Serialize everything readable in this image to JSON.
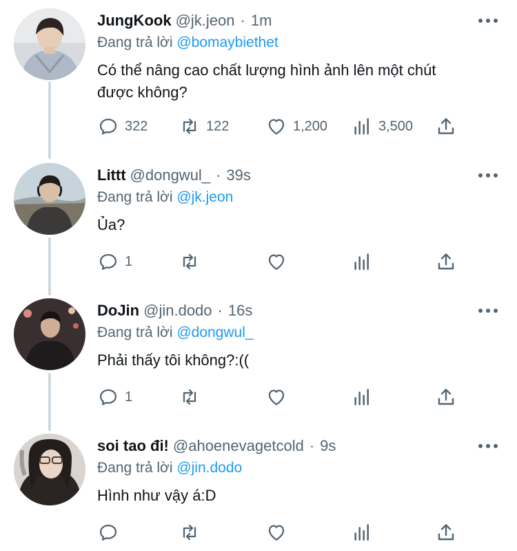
{
  "tweets": [
    {
      "name": "JungKook",
      "handle": "@jk.jeon",
      "time": "1m",
      "reply_prefix": "Đang trả lời",
      "reply_to": "@bomaybiethet",
      "text_lines": [
        "Có thể nâng cao chất lượng hình ảnh lên một chút",
        "được không?"
      ],
      "replies": "322",
      "retweets": "122",
      "likes": "1,200",
      "views": "3,500"
    },
    {
      "name": "Littt",
      "handle": "@dongwul_",
      "time": "39s",
      "reply_prefix": "Đang trả lời",
      "reply_to": "@jk.jeon",
      "text_lines": [
        "Ủa?"
      ],
      "replies": "1",
      "retweets": "",
      "likes": "",
      "views": ""
    },
    {
      "name": "DoJin",
      "handle": "@jin.dodo",
      "time": "16s",
      "reply_prefix": "Đang trả lời",
      "reply_to": "@dongwul_",
      "text_lines": [
        "Phải thấy tôi không?:(("
      ],
      "replies": "1",
      "retweets": "",
      "likes": "",
      "views": ""
    },
    {
      "name": "soi tao đi!",
      "handle": "@ahoenevagetcold",
      "time": "9s",
      "reply_prefix": "Đang trả lời",
      "reply_to": "@jin.dodo",
      "text_lines": [
        "Hình như vậy á:D"
      ],
      "replies": "",
      "retweets": "",
      "likes": "",
      "views": ""
    }
  ],
  "separator": "·",
  "icons": {
    "reply": "reply-icon",
    "retweet": "retweet-icon",
    "like": "heart-icon",
    "views": "views-icon",
    "share": "share-icon",
    "more": "more-icon"
  },
  "colors": {
    "text": "#0f1419",
    "secondary": "#536471",
    "link": "#1d9bf0",
    "thread_line": "#cfd9de"
  }
}
